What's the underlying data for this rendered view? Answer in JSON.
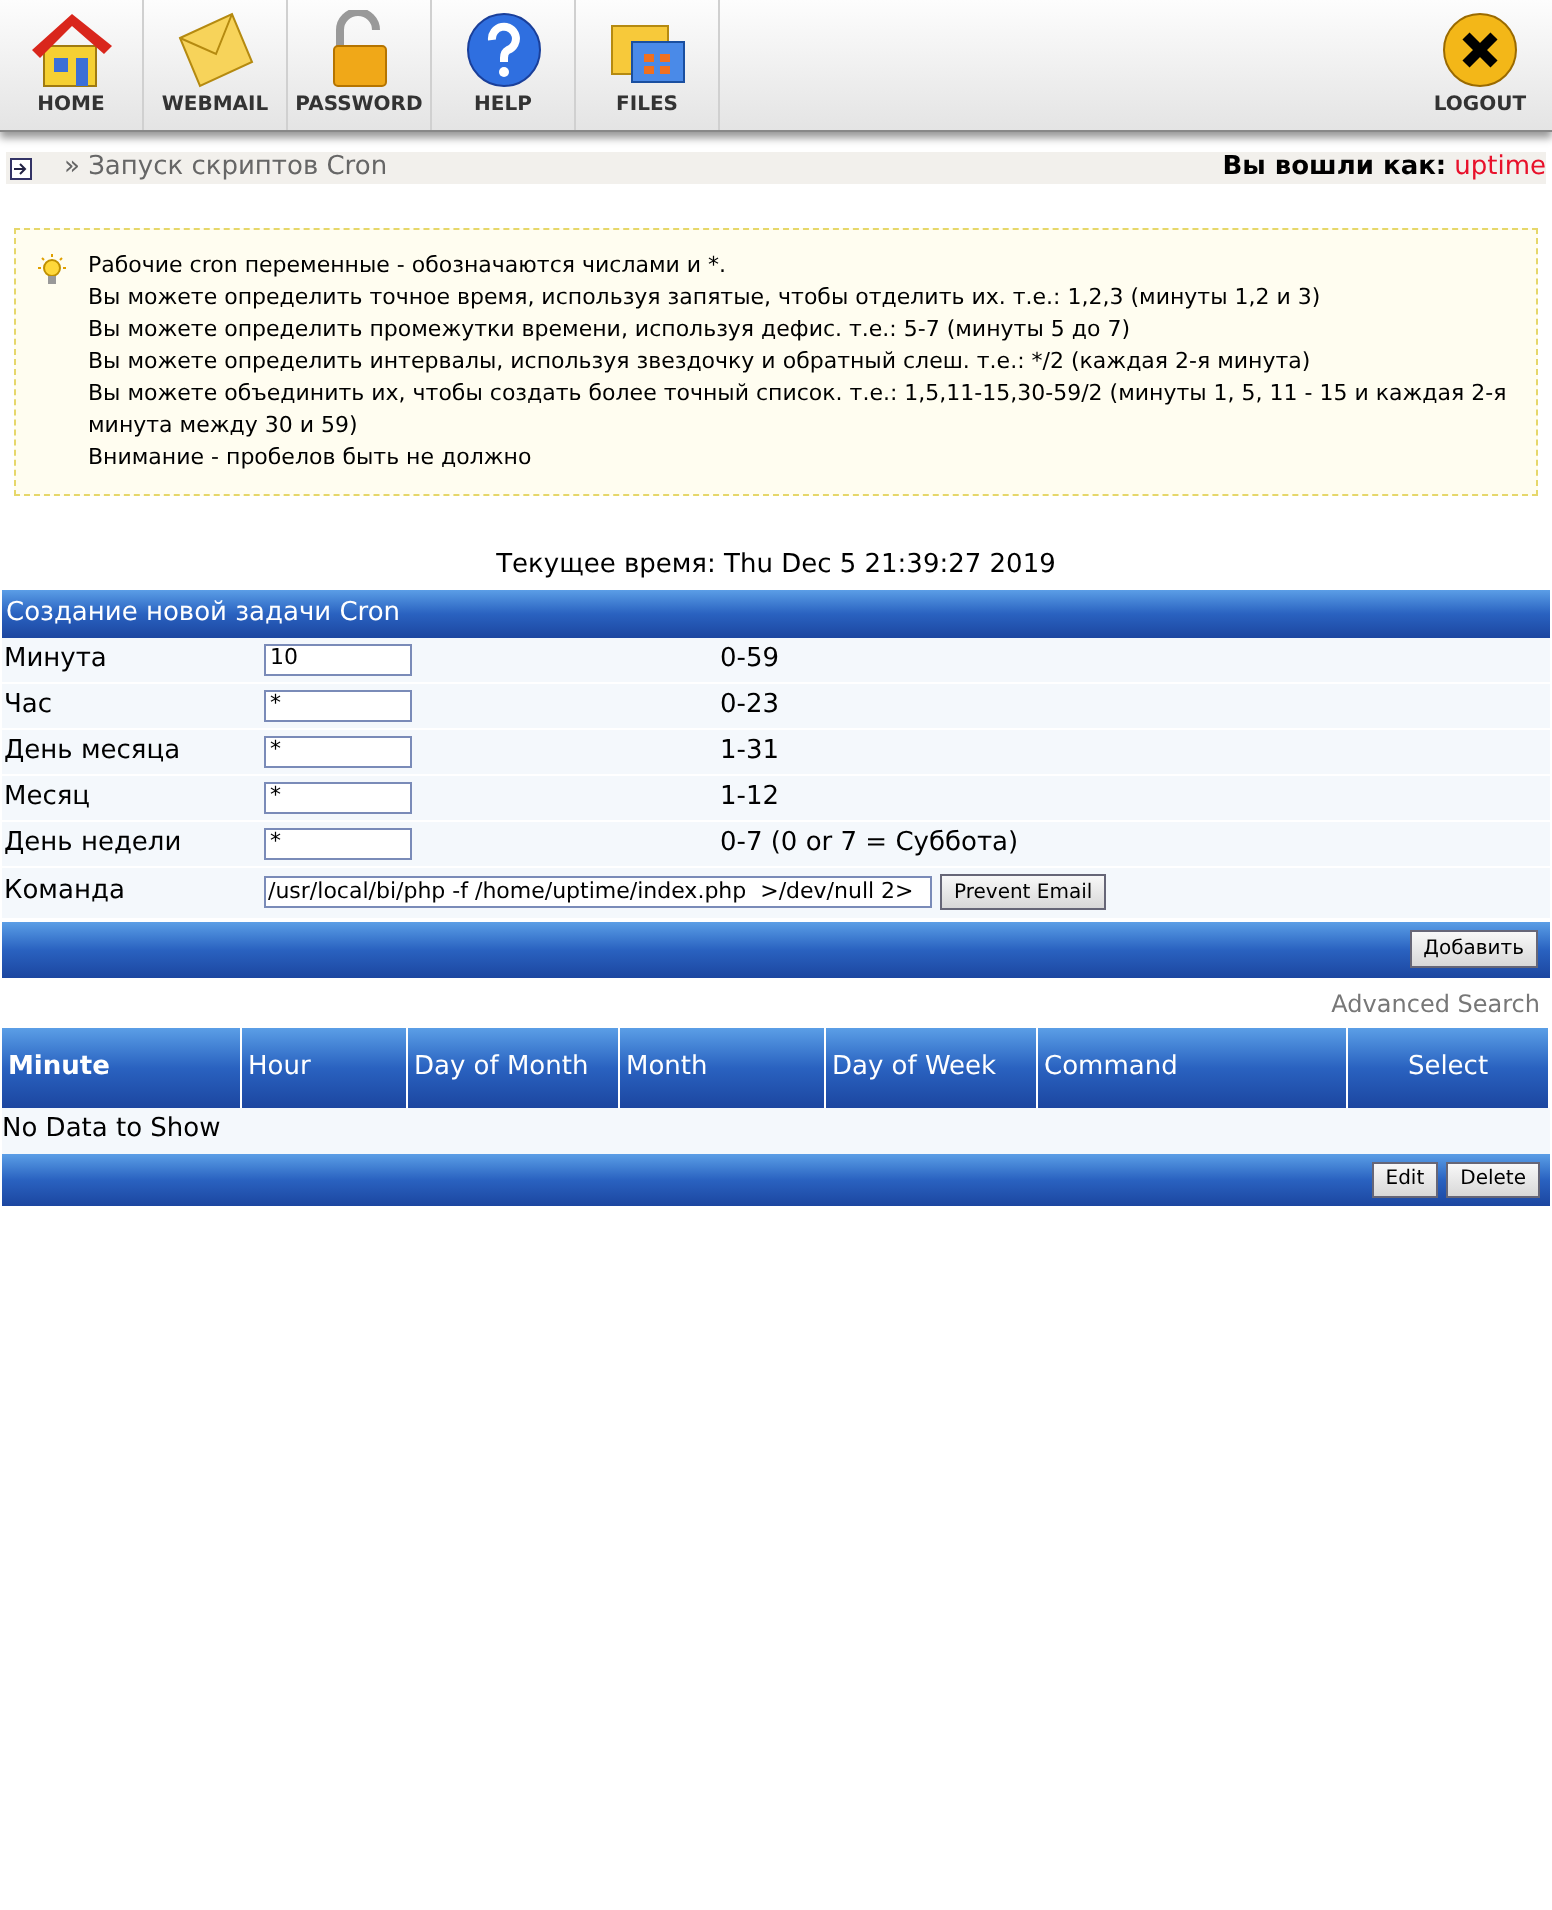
{
  "toolbar": {
    "items": [
      {
        "label": "HOME",
        "kind": "home"
      },
      {
        "label": "WEBMAIL",
        "kind": "mail"
      },
      {
        "label": "PASSWORD",
        "kind": "lock"
      },
      {
        "label": "HELP",
        "kind": "help"
      },
      {
        "label": "FILES",
        "kind": "files"
      }
    ],
    "logout": "LOGOUT"
  },
  "breadcrumb": {
    "path": "» Запуск скриптов Cron",
    "logged_in_label": "Вы вошли как:",
    "user": "uptime"
  },
  "info": [
    "Рабочие cron переменные - обозначаются числами и *.",
    "Вы можете определить точное время, используя запятые, чтобы отделить их. т.е.: 1,2,3 (минуты 1,2 и 3)",
    "Вы можете определить промежутки времени, используя дефис. т.е.: 5-7 (минуты 5 до 7)",
    "Вы можете определить интервалы, используя звездочку и обратный слеш. т.е.: */2 (каждая 2-я минута)",
    "Вы можете объединить их, чтобы создать более точный список. т.е.: 1,5,11-15,30-59/2 (минуты 1, 5, 11 - 15 и каждая 2-я минута между 30 и 59)",
    "Внимание - пробелов быть не должно"
  ],
  "current_time": "Текущее время: Thu Dec 5 21:39:27 2019",
  "form": {
    "title": "Создание новой задачи Cron",
    "fields": [
      {
        "label": "Минута",
        "value": "10",
        "range": "0-59"
      },
      {
        "label": "Час",
        "value": "*",
        "range": "0-23"
      },
      {
        "label": "День месяца",
        "value": "*",
        "range": "1-31"
      },
      {
        "label": "Месяц",
        "value": "*",
        "range": "1-12"
      },
      {
        "label": "День недели",
        "value": "*",
        "range": "0-7 (0 or 7 = Суббота)"
      }
    ],
    "command": {
      "label": "Команда",
      "value": "/usr/local/bi/php -f /home/uptime/index.php  >/dev/null 2>",
      "button": "Prevent Email"
    },
    "submit": "Добавить"
  },
  "advanced_search": "Advanced Search",
  "table": {
    "columns": [
      "Minute",
      "Hour",
      "Day of Month",
      "Month",
      "Day of Week",
      "Command",
      "Select"
    ],
    "empty": "No Data to Show",
    "buttons": [
      "Edit",
      "Delete"
    ]
  }
}
